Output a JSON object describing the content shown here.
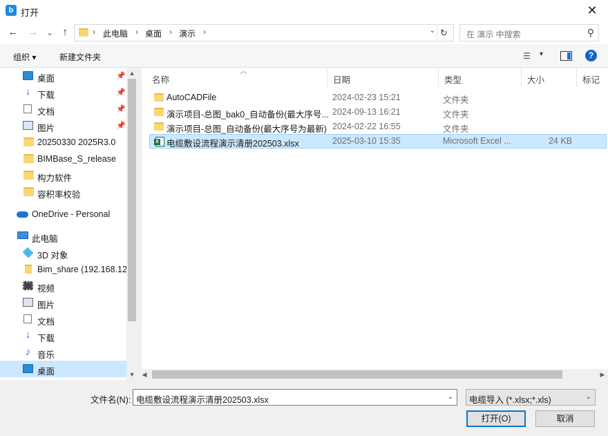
{
  "window": {
    "title": "打开",
    "app_icon": "b"
  },
  "nav": {
    "back": "←",
    "forward": "→",
    "recent": "⌄",
    "up": "↑",
    "breadcrumb": [
      "此电脑",
      "桌面",
      "演示"
    ],
    "separator": "›",
    "dropdown": "⌄",
    "refresh": "↻",
    "search_placeholder": "在 演示 中搜索"
  },
  "toolbar": {
    "organize": "组织 ▾",
    "new_folder": "新建文件夹"
  },
  "sidebar": {
    "quick_access": [
      {
        "label": "桌面",
        "icon": "desktop-icon",
        "pinned": true
      },
      {
        "label": "下载",
        "icon": "download-icon",
        "pinned": true
      },
      {
        "label": "文档",
        "icon": "document-icon",
        "pinned": true
      },
      {
        "label": "图片",
        "icon": "picture-icon",
        "pinned": true
      },
      {
        "label": "20250330 2025R3.0",
        "icon": "folder-icon"
      },
      {
        "label": "BIMBase_S_release",
        "icon": "folder-icon"
      },
      {
        "label": "构力软件",
        "icon": "folder-icon"
      },
      {
        "label": "容积率校验",
        "icon": "folder-icon"
      }
    ],
    "onedrive": "OneDrive - Personal",
    "this_pc": "此电脑",
    "pc_items": [
      {
        "label": "3D 对象",
        "icon": "3d-objects-icon"
      },
      {
        "label": "Bim_share (192.168.12",
        "icon": "network-drive-icon"
      },
      {
        "label": "视频",
        "icon": "video-icon"
      },
      {
        "label": "图片",
        "icon": "picture-icon"
      },
      {
        "label": "文档",
        "icon": "document-icon"
      },
      {
        "label": "下载",
        "icon": "download-icon"
      },
      {
        "label": "音乐",
        "icon": "music-icon"
      },
      {
        "label": "桌面",
        "icon": "desktop-icon",
        "selected": true
      }
    ]
  },
  "columns": {
    "name": "名称",
    "date": "日期",
    "type": "类型",
    "size": "大小",
    "tags": "标记"
  },
  "files": [
    {
      "name": "AutoCADFile",
      "date": "2024-02-23 15:21",
      "type": "文件夹",
      "size": "",
      "icon": "folder-icon"
    },
    {
      "name": "演示项目-总图_bak0_自动备份(最大序号...",
      "date": "2024-09-13 16:21",
      "type": "文件夹",
      "size": "",
      "icon": "folder-icon"
    },
    {
      "name": "演示项目-总图_自动备份(最大序号为最新)",
      "date": "2024-02-22 16:55",
      "type": "文件夹",
      "size": "",
      "icon": "folder-icon"
    },
    {
      "name": "电缆敷设流程演示清册202503.xlsx",
      "date": "2025-03-10 15:35",
      "type": "Microsoft Excel ...",
      "size": "24 KB",
      "icon": "excel-icon",
      "selected": true
    }
  ],
  "bottom": {
    "filename_label": "文件名(N):",
    "filename_value": "电缆敷设流程演示清册202503.xlsx",
    "filter_value": "电缆导入 (*.xlsx;*.xls)",
    "open_button": "打开(O)",
    "cancel_button": "取消"
  }
}
